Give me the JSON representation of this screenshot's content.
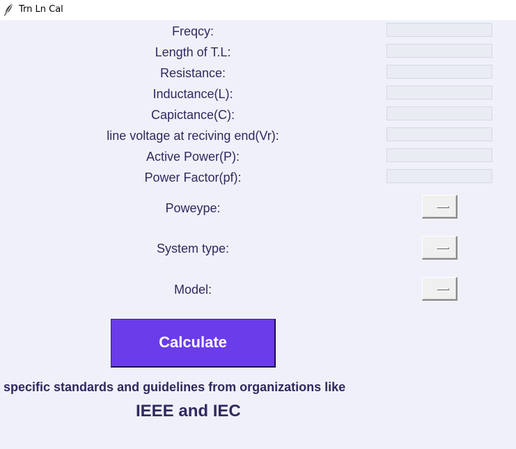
{
  "window": {
    "title": "Trn Ln Cal",
    "icon": "feather-icon"
  },
  "form": {
    "fields": [
      {
        "label": "Freqcy:",
        "value": ""
      },
      {
        "label": "Length of T.L:",
        "value": ""
      },
      {
        "label": "Resistance:",
        "value": ""
      },
      {
        "label": "Inductance(L):",
        "value": ""
      },
      {
        "label": "Capictance(C):",
        "value": ""
      },
      {
        "label": "line voltage at reciving end(Vr):",
        "value": ""
      },
      {
        "label": "Active Power(P):",
        "value": ""
      },
      {
        "label": "Power Factor(pf):",
        "value": ""
      }
    ],
    "options": [
      {
        "label": "Poweype:",
        "selected": ""
      },
      {
        "label": "System type:",
        "selected": ""
      },
      {
        "label": "Model:",
        "selected": ""
      }
    ]
  },
  "actions": {
    "calculate_label": "Calculate"
  },
  "footer": {
    "line1": "specific standards and guidelines from organizations like",
    "line2": "IEEE and IEC"
  },
  "colors": {
    "background": "#f0f0fa",
    "text": "#2e2a5e",
    "button": "#6a3cea",
    "button_text": "#ffffff",
    "entry_background": "#e9ecf3"
  }
}
